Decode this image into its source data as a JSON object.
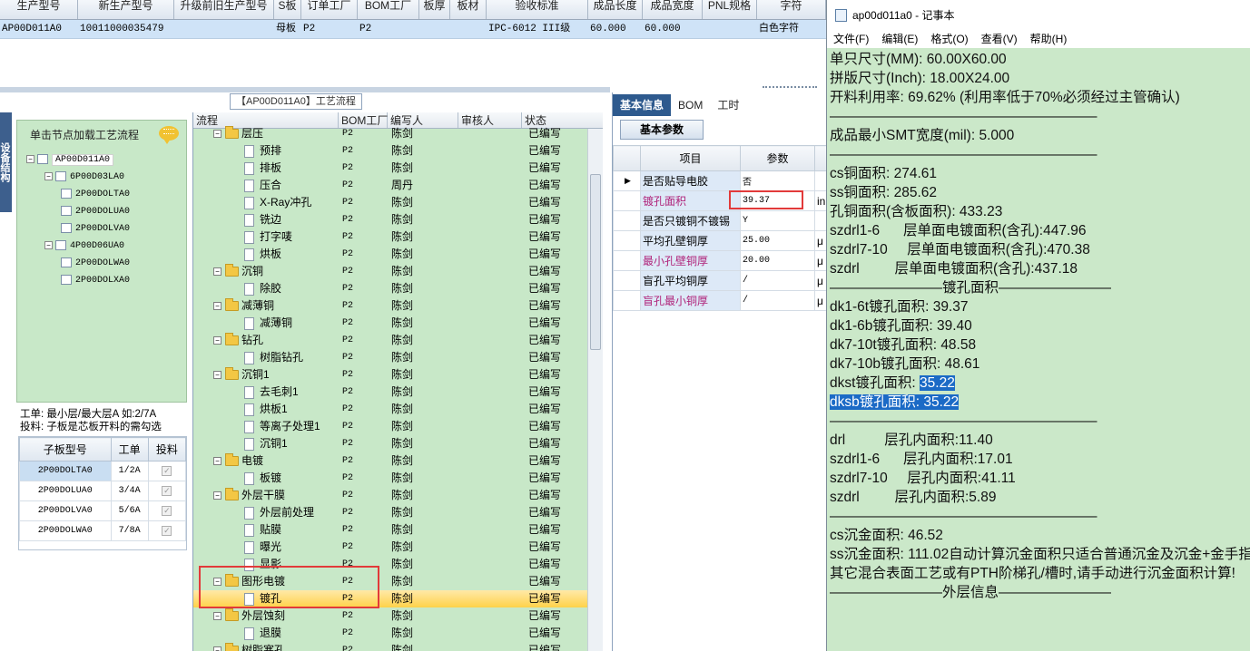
{
  "top_grid": {
    "columns": [
      "生产型号",
      "新生产型号",
      "升级前旧生产型号",
      "S板",
      "订单工厂",
      "BOM工厂",
      "板厚",
      "板材",
      "验收标准",
      "成品长度",
      "成品宽度",
      "PNL规格",
      "字符"
    ],
    "row": [
      "AP00D011A0",
      "10011000035479",
      "",
      "母板",
      "P2",
      "P2",
      "",
      "",
      "IPC-6012 III级",
      "60.000",
      "60.000",
      "",
      "白色字符"
    ]
  },
  "left_panel": {
    "strip_label": "设备结构",
    "tree_title": "单击节点加载工艺流程",
    "tree": [
      {
        "label": "AP00D011A0"
      },
      {
        "label": "6P00D03LA0"
      },
      {
        "label": "2P00DOLTA0"
      },
      {
        "label": "2P00DOLUA0"
      },
      {
        "label": "2P00DOLVA0"
      },
      {
        "label": "4P00D06UA0"
      },
      {
        "label": "2P00DOLWA0"
      },
      {
        "label": "2P00DOLXA0"
      }
    ],
    "info_line1": "工单: 最小层/最大层A 如:2/7A",
    "info_line2": "投料: 子板是芯板开料的需勾选",
    "sub_grid": {
      "headers": [
        "子板型号",
        "工单",
        "投料"
      ],
      "rows": [
        [
          "2P00DOLTA0",
          "1/2A"
        ],
        [
          "2P00DOLUA0",
          "3/4A"
        ],
        [
          "2P00DOLVA0",
          "5/6A"
        ],
        [
          "2P00DOLWA0",
          "7/8A"
        ]
      ]
    }
  },
  "process": {
    "tab_title": "【AP00D011A0】工艺流程",
    "headers": [
      "流程",
      "BOM工厂",
      "编写人",
      "审核人",
      "状态"
    ],
    "rows": [
      {
        "name": "层压",
        "folder": true,
        "bom": "P2",
        "author": "陈剑",
        "status": "已编写"
      },
      {
        "name": "预排",
        "folder": false,
        "bom": "P2",
        "author": "陈剑",
        "status": "已编写"
      },
      {
        "name": "排板",
        "folder": false,
        "bom": "P2",
        "author": "陈剑",
        "status": "已编写"
      },
      {
        "name": "压合",
        "folder": false,
        "bom": "P2",
        "author": "周丹",
        "status": "已编写"
      },
      {
        "name": "X-Ray冲孔",
        "folder": false,
        "bom": "P2",
        "author": "陈剑",
        "status": "已编写"
      },
      {
        "name": "铣边",
        "folder": false,
        "bom": "P2",
        "author": "陈剑",
        "status": "已编写"
      },
      {
        "name": "打字唛",
        "folder": false,
        "bom": "P2",
        "author": "陈剑",
        "status": "已编写"
      },
      {
        "name": "烘板",
        "folder": false,
        "bom": "P2",
        "author": "陈剑",
        "status": "已编写"
      },
      {
        "name": "沉铜",
        "folder": true,
        "bom": "P2",
        "author": "陈剑",
        "status": "已编写"
      },
      {
        "name": "除胶",
        "folder": false,
        "bom": "P2",
        "author": "陈剑",
        "status": "已编写"
      },
      {
        "name": "减薄铜",
        "folder": true,
        "bom": "P2",
        "author": "陈剑",
        "status": "已编写"
      },
      {
        "name": "减薄铜",
        "folder": false,
        "bom": "P2",
        "author": "陈剑",
        "status": "已编写"
      },
      {
        "name": "钻孔",
        "folder": true,
        "bom": "P2",
        "author": "陈剑",
        "status": "已编写"
      },
      {
        "name": "树脂钻孔",
        "folder": false,
        "bom": "P2",
        "author": "陈剑",
        "status": "已编写"
      },
      {
        "name": "沉铜1",
        "folder": true,
        "bom": "P2",
        "author": "陈剑",
        "status": "已编写"
      },
      {
        "name": "去毛刺1",
        "folder": false,
        "bom": "P2",
        "author": "陈剑",
        "status": "已编写"
      },
      {
        "name": "烘板1",
        "folder": false,
        "bom": "P2",
        "author": "陈剑",
        "status": "已编写"
      },
      {
        "name": "等离子处理1",
        "folder": false,
        "bom": "P2",
        "author": "陈剑",
        "status": "已编写"
      },
      {
        "name": "沉铜1",
        "folder": false,
        "bom": "P2",
        "author": "陈剑",
        "status": "已编写"
      },
      {
        "name": "电镀",
        "folder": true,
        "bom": "P2",
        "author": "陈剑",
        "status": "已编写"
      },
      {
        "name": "板镀",
        "folder": false,
        "bom": "P2",
        "author": "陈剑",
        "status": "已编写"
      },
      {
        "name": "外层干膜",
        "folder": true,
        "bom": "P2",
        "author": "陈剑",
        "status": "已编写"
      },
      {
        "name": "外层前处理",
        "folder": false,
        "bom": "P2",
        "author": "陈剑",
        "status": "已编写"
      },
      {
        "name": "贴膜",
        "folder": false,
        "bom": "P2",
        "author": "陈剑",
        "status": "已编写"
      },
      {
        "name": "曝光",
        "folder": false,
        "bom": "P2",
        "author": "陈剑",
        "status": "已编写"
      },
      {
        "name": "显影",
        "folder": false,
        "bom": "P2",
        "author": "陈剑",
        "status": "已编写"
      },
      {
        "name": "图形电镀",
        "folder": true,
        "bom": "P2",
        "author": "陈剑",
        "status": "已编写"
      },
      {
        "name": "镀孔",
        "folder": false,
        "bom": "P2",
        "author": "陈剑",
        "status": "已编写",
        "selected": true
      },
      {
        "name": "外层蚀刻",
        "folder": true,
        "bom": "P2",
        "author": "陈剑",
        "status": "已编写"
      },
      {
        "name": "退膜",
        "folder": false,
        "bom": "P2",
        "author": "陈剑",
        "status": "已编写"
      },
      {
        "name": "树脂塞孔",
        "folder": true,
        "bom": "P2",
        "author": "陈剑",
        "status": "已编写"
      }
    ]
  },
  "info_panel": {
    "tabs": [
      "基本信息",
      "BOM",
      "工时"
    ],
    "subtab": "基本参数",
    "headers": [
      "项目",
      "参数"
    ],
    "rows": [
      {
        "label": "是否贴导电胶",
        "value": "否",
        "pink": false
      },
      {
        "label": "镀孔面积",
        "value": "39.37",
        "pink": true,
        "unit": "in"
      },
      {
        "label": "是否只镀铜不镀锡",
        "value": "Y",
        "pink": false
      },
      {
        "label": "平均孔壁铜厚",
        "value": "25.00",
        "pink": false,
        "unit": "μ"
      },
      {
        "label": "最小孔壁铜厚",
        "value": "20.00",
        "pink": true,
        "unit": "μ"
      },
      {
        "label": "盲孔平均铜厚",
        "value": "/",
        "pink": false,
        "unit": "μ"
      },
      {
        "label": "盲孔最小铜厚",
        "value": "/",
        "pink": true,
        "unit": "μ"
      }
    ]
  },
  "notepad": {
    "title": "ap00d011a0 - 记事本",
    "menu": [
      "文件(F)",
      "编辑(E)",
      "格式(O)",
      "查看(V)",
      "帮助(H)"
    ],
    "lines": [
      "单只尺寸(MM): 60.00X60.00",
      "拼版尺寸(Inch): 18.00X24.00",
      "开料利用率: 69.62% (利用率低于70%必须经过主管确认)",
      "———————————————————",
      "成品最小SMT宽度(mil): 5.000",
      "———————————————————",
      "cs铜面积: 274.61",
      "ss铜面积: 285.62",
      "孔铜面积(含板面积): 433.23",
      "szdrl1-6      层单面电镀面积(含孔):447.96",
      "szdrl7-10     层单面电镀面积(含孔):470.38",
      "szdrl         层单面电镀面积(含孔):437.18",
      "",
      "————————镀孔面积————————",
      "dk1-6t镀孔面积: 39.37",
      "dk1-6b镀孔面积: 39.40",
      "dk7-10t镀孔面积: 48.58",
      "dk7-10b镀孔面积: 48.61",
      "dkst镀孔面积: ",
      "dksb镀孔面积: 35.22",
      "",
      "———————————————————",
      "drl          层孔内面积:11.40",
      "szdrl1-6      层孔内面积:17.01",
      "szdrl7-10     层孔内面积:41.11",
      "szdrl         层孔内面积:5.89",
      "",
      "———————————————————",
      "cs沉金面积: 46.52",
      "ss沉金面积: 111.02自动计算沉金面积只适合普通沉金及沉金+金手指",
      "其它混合表面工艺或有PTH阶梯孔/槽时,请手动进行沉金面积计算!",
      "————————外层信息————————"
    ],
    "highlight_dkst": "35.22"
  }
}
